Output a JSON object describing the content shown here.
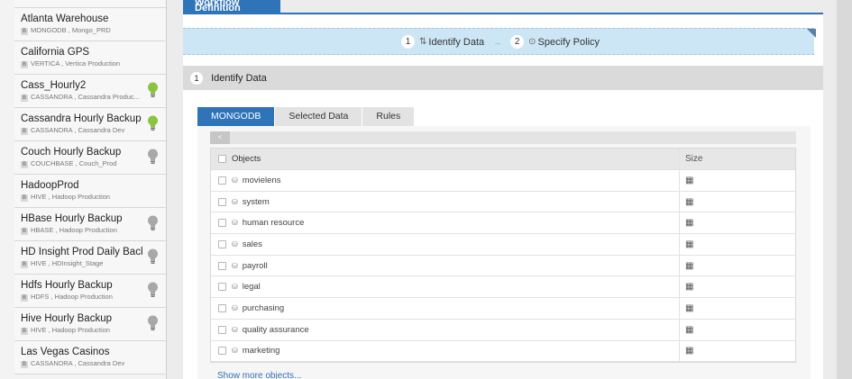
{
  "sidebar": {
    "items": [
      {
        "name": "",
        "sub": "",
        "badge": "",
        "bulb": ""
      },
      {
        "name": "Atlanta Warehouse",
        "sub": "MONGODB , Mongo_PRD",
        "badge": "B",
        "bulb": ""
      },
      {
        "name": "California GPS",
        "sub": "VERTICA , Vertica Production",
        "badge": "B",
        "bulb": ""
      },
      {
        "name": "Cass_Hourly2",
        "sub": "CASSANDRA , Cassandra Produc...",
        "badge": "B",
        "bulb": "green"
      },
      {
        "name": "Cassandra Hourly Backup",
        "sub": "CASSANDRA , Cassandra Dev",
        "badge": "B",
        "bulb": "green"
      },
      {
        "name": "Couch Hourly Backup",
        "sub": "COUCHBASE , Couch_Prod",
        "badge": "B",
        "bulb": "gray"
      },
      {
        "name": "HadoopProd",
        "sub": "HIVE , Hadoop Production",
        "badge": "B",
        "bulb": ""
      },
      {
        "name": "HBase Hourly Backup",
        "sub": "HBASE , Hadoop Production",
        "badge": "B",
        "bulb": "gray"
      },
      {
        "name": "HD Insight Prod Daily Back...",
        "sub": "HIVE , HDInsight_Stage",
        "badge": "B",
        "bulb": "gray"
      },
      {
        "name": "Hdfs Hourly Backup",
        "sub": "HDFS , Hadoop Production",
        "badge": "B",
        "bulb": "gray"
      },
      {
        "name": "Hive Hourly Backup",
        "sub": "HIVE , Hadoop Production",
        "badge": "B",
        "bulb": "gray"
      },
      {
        "name": "Las Vegas Casinos",
        "sub": "CASSANDRA , Cassandra Dev",
        "badge": "B",
        "bulb": ""
      }
    ]
  },
  "header": {
    "tab_label": "Workflow Definition"
  },
  "steps": {
    "step1_num": "1",
    "step1_label": "Identify Data",
    "step2_num": "2",
    "step2_label": "Specify Policy",
    "arrow": "→"
  },
  "section": {
    "num": "1",
    "title": "Identify Data"
  },
  "tabs": [
    "MONGODB",
    "Selected Data",
    "Rules"
  ],
  "table": {
    "collapse_label": "<",
    "col_objects": "Objects",
    "col_size": "Size",
    "rows": [
      "movielens",
      "system",
      "human resource",
      "sales",
      "payroll",
      "legal",
      "purchasing",
      "quality assurance",
      "marketing"
    ],
    "show_more": "Show more objects..."
  },
  "colors": {
    "accent": "#2f73b8",
    "bulb_green": "#8bc53f",
    "bulb_gray": "#a8a8a8",
    "steps_bg": "#cde6f5"
  }
}
